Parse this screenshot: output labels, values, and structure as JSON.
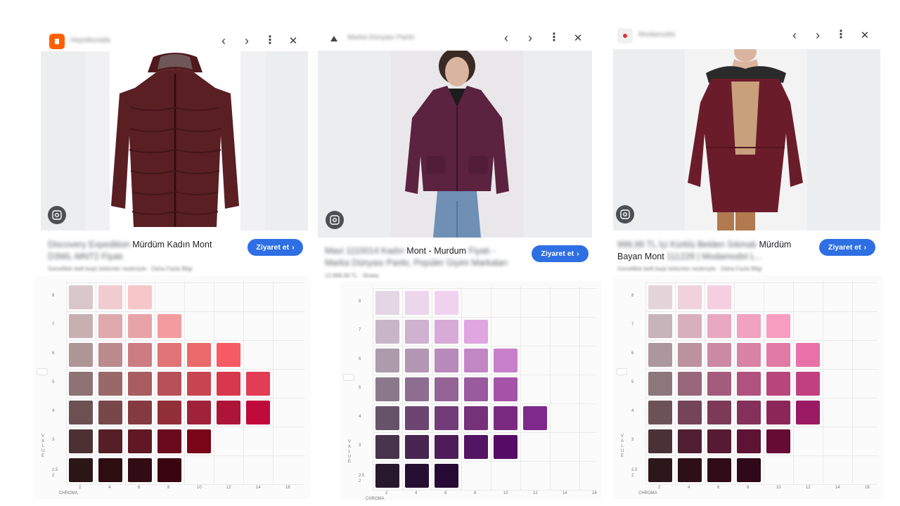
{
  "cards": [
    {
      "site": "Hepsiburada",
      "badge_color": "#ff6000",
      "back_icon": "chevron-left-icon",
      "forward_icon": "chevron-right-icon",
      "more_icon": "more-vert-icon",
      "close_icon": "close-icon",
      "back": "‹",
      "forward": "›",
      "more": "⋮",
      "close": "✕",
      "title_blur": "Discovery Expedition",
      "title_clear": " Mürdüm Kadın Mont",
      "title_line2": "D3WL-MNT2 Fiyatı",
      "title_line2_clear": "",
      "subnote": "Genellikle belli başlı bölümler nedeniyle · Daha Fazla Bilgi",
      "visit": "Ziyaret et",
      "visit_icon": "›",
      "jacket_color": "#5a1f22"
    },
    {
      "site": "Marka Dünyası Panlo",
      "badge_color": "#444444",
      "back_icon": "chevron-left-icon",
      "forward_icon": "chevron-right-icon",
      "more_icon": "more-vert-icon",
      "close_icon": "close-icon",
      "back": "‹",
      "forward": "›",
      "more": "⋮",
      "close": "✕",
      "title_blur": "Mavi 1110014 Kadın ",
      "title_clear": "Mont - Murdum",
      "title_blur2": " Fiyatı -",
      "title_line2": "Marka Dünyası Panlo, Popüler Giyim Markaları",
      "title_line2_clear": "",
      "subnote": "12.999,99 TL · Stokta",
      "visit": "Ziyaret et",
      "visit_icon": "›",
      "jacket_color": "#5b2340"
    },
    {
      "site": "Modamodst",
      "badge_color": "#e8e8e8",
      "back_icon": "chevron-left-icon",
      "forward_icon": "chevron-right-icon",
      "more_icon": "more-vert-icon",
      "close_icon": "close-icon",
      "back": "‹",
      "forward": "›",
      "more": "⋮",
      "close": "✕",
      "title_blur": "999,99 TL İçi Kürklü Belden Sıkmalı ",
      "title_clear": "Mürdüm",
      "title_line2": "Bayan Mont",
      "title_line2_blur": " 111228 | Modamodst L...",
      "title_line2_clear": "Bayan Mont",
      "subnote": "Genellikle belli başlı bölümler nedeniyle · Daha Fazla Bilgi",
      "visit": "Ziyaret et",
      "visit_icon": "›",
      "jacket_color": "#6b1c2a"
    }
  ],
  "charts": [
    {
      "hue": "red-purple 5RP",
      "value_ticks": [
        "8",
        "7",
        "6",
        "5",
        "4",
        "3",
        "2.5",
        "2"
      ],
      "chroma_ticks": [
        "2",
        "4",
        "6",
        "8",
        "10",
        "12",
        "14",
        "16"
      ],
      "axis_value": "VALUE",
      "axis_chroma": "CHROMA",
      "rows": [
        [
          "#d9c8cb",
          "#f0ccd0",
          "#f6c6c9"
        ],
        [
          "#c7b0b2",
          "#dfa9ad",
          "#e8a3a8",
          "#f39ca0"
        ],
        [
          "#ae9596",
          "#bb8a8c",
          "#cd7c82",
          "#e07376",
          "#ea6a6b",
          "#f65a62"
        ],
        [
          "#8d7373",
          "#9a6868",
          "#a95d60",
          "#b8505a",
          "#c94451",
          "#d7384b",
          "#e23d55"
        ],
        [
          "#6b5152",
          "#78474a",
          "#853a41",
          "#912f38",
          "#a0223a",
          "#ae1438",
          "#c00a3b"
        ],
        [
          "#4b3133",
          "#561f28",
          "#611824",
          "#6b0a1f",
          "#7a0418"
        ],
        [
          "#2a1517",
          "#2d0d12",
          "#320c14",
          "#3a0410"
        ]
      ]
    },
    {
      "hue": "purple 5P",
      "value_ticks": [
        "8",
        "7",
        "6",
        "5",
        "4",
        "3",
        "2.5",
        "2"
      ],
      "chroma_ticks": [
        "2",
        "4",
        "6",
        "8",
        "10",
        "12",
        "14",
        "16"
      ],
      "axis_value": "VALUE",
      "axis_chroma": "CHROMA",
      "rows": [
        [
          "#e4d6e4",
          "#ecd6ec",
          "#f0d2ef"
        ],
        [
          "#c8b6c8",
          "#ceb2cf",
          "#d8aad8",
          "#e0a6e1"
        ],
        [
          "#ab9bab",
          "#b397b4",
          "#b88ab9",
          "#c286c4",
          "#c980ca"
        ],
        [
          "#8a788b",
          "#8d6d90",
          "#946497",
          "#9a5a9e",
          "#a453a7"
        ],
        [
          "#66536a",
          "#6c4670",
          "#713c77",
          "#75327b",
          "#7a2a81",
          "#7e2a8c"
        ],
        [
          "#47344c",
          "#492652",
          "#4e1d59",
          "#531463",
          "#560c66"
        ],
        [
          "#27182c",
          "#261032",
          "#260a34"
        ]
      ]
    },
    {
      "hue": "red-purple 5RP",
      "value_ticks": [
        "8",
        "7",
        "6",
        "5",
        "4",
        "3",
        "2.5",
        "2"
      ],
      "chroma_ticks": [
        "2",
        "4",
        "6",
        "8",
        "10",
        "12",
        "14",
        "16"
      ],
      "axis_value": "VALUE",
      "axis_chroma": "CHROMA",
      "rows": [
        [
          "#e3d5da",
          "#efd2dc",
          "#f5cfdf"
        ],
        [
          "#c7b4ba",
          "#d8b0bd",
          "#e8a9c0",
          "#f1a2bf",
          "#f99dc0"
        ],
        [
          "#ab979d",
          "#bb929d",
          "#cb8aa2",
          "#d883a5",
          "#e17aa4",
          "#e871a7"
        ],
        [
          "#8c777c",
          "#98687a",
          "#a45c7d",
          "#af527e",
          "#b8467d",
          "#c14080"
        ],
        [
          "#6b5258",
          "#744457",
          "#7c3a57",
          "#84305a",
          "#8c2659",
          "#9a1a64"
        ],
        [
          "#4a3137",
          "#521f32",
          "#581a33",
          "#5e1234",
          "#650b34"
        ],
        [
          "#2c171b",
          "#2d0f18",
          "#2e0b17",
          "#2f0917"
        ]
      ]
    }
  ]
}
